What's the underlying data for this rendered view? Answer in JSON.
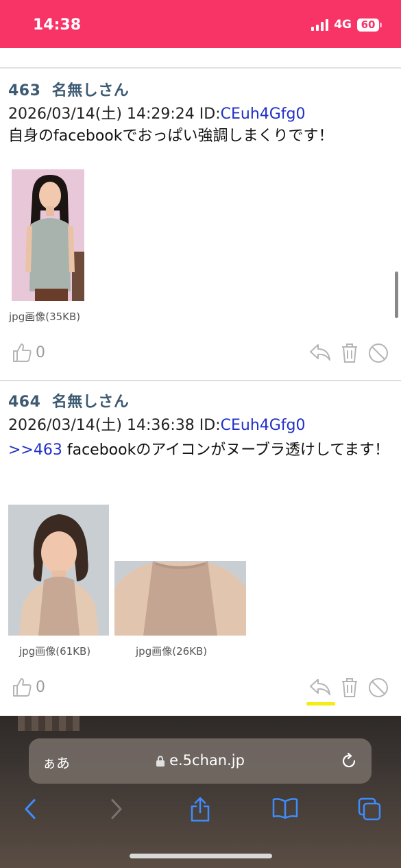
{
  "status_bar": {
    "time": "14:38",
    "network": "4G",
    "battery": "60",
    "color": "#f83467"
  },
  "posts": [
    {
      "number": "463",
      "name": "名無しさん",
      "datetime": "2026/03/14(土) 14:29:24 ID:",
      "id": "CEuh4Gfg0",
      "anchor": "",
      "text": "自身のfacebookでおっぱい強調しまくりです！",
      "images": [
        {
          "caption": "jpg画像(35KB)"
        }
      ],
      "likes": "0"
    },
    {
      "number": "464",
      "name": "名無しさん",
      "datetime": "2026/03/14(土) 14:36:38 ID:",
      "id": "CEuh4Gfg0",
      "anchor": ">>463",
      "text": " facebookのアイコンがヌーブラ透けしてます！",
      "images": [
        {
          "caption": "jpg画像(61KB)"
        },
        {
          "caption": "jpg画像(26KB)"
        }
      ],
      "likes": "0"
    }
  ],
  "browser": {
    "text_size_label": "ぁあ",
    "domain": "e.5chan.jp"
  },
  "icons": [
    "thumbs-up-icon",
    "reply-icon",
    "trash-icon",
    "block-icon",
    "lock-icon",
    "reload-icon",
    "back-icon",
    "forward-icon",
    "share-icon",
    "bookmarks-icon",
    "tabs-icon"
  ],
  "colors": {
    "header_text": "#3d5a73",
    "link": "#2030c8",
    "highlight": "#f5ec13"
  }
}
